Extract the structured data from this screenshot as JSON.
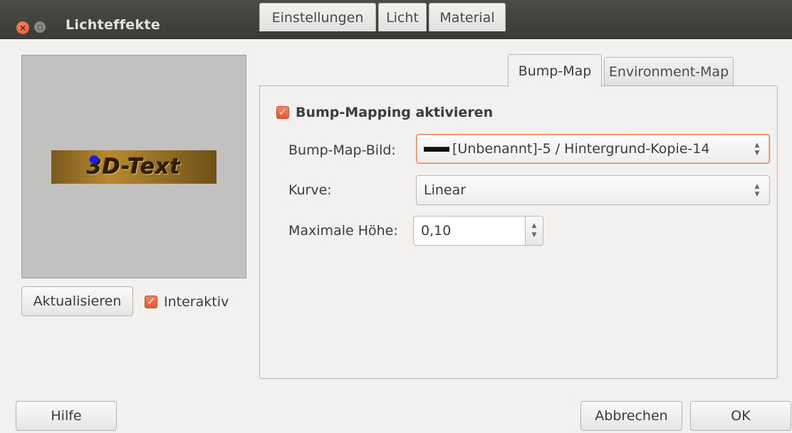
{
  "window": {
    "title": "Lichteffekte"
  },
  "preview": {
    "text": "3D-Text"
  },
  "left": {
    "refresh_label": "Aktualisieren",
    "interactive_label": "Interaktiv",
    "interactive_checked": true
  },
  "tabs": [
    {
      "label": "Einstellungen",
      "active": false
    },
    {
      "label": "Licht",
      "active": false
    },
    {
      "label": "Material",
      "active": false
    },
    {
      "label": "Bump-Map",
      "active": true
    },
    {
      "label": "Environment-Map",
      "active": false
    }
  ],
  "bumpmap": {
    "enable_label": "Bump-Mapping aktivieren",
    "enable_checked": true,
    "image_label": "Bump-Map-Bild:",
    "image_value": "[Unbenannt]-5 / Hintergrund-Kopie-14",
    "curve_label": "Kurve:",
    "curve_value": "Linear",
    "max_height_label": "Maximale Höhe:",
    "max_height_value": "0,10"
  },
  "footer": {
    "help_label": "Hilfe",
    "cancel_label": "Abbrechen",
    "ok_label": "OK"
  },
  "icons": {
    "close": "close-icon",
    "minimize": "minimize-icon",
    "check": "check-icon",
    "spin_arrows": "updown-arrows-icon"
  },
  "colors": {
    "accent": "#e0592b",
    "titlebar": "#3b3a36",
    "background": "#f2f1f0",
    "light_marker": "#1020e8"
  }
}
